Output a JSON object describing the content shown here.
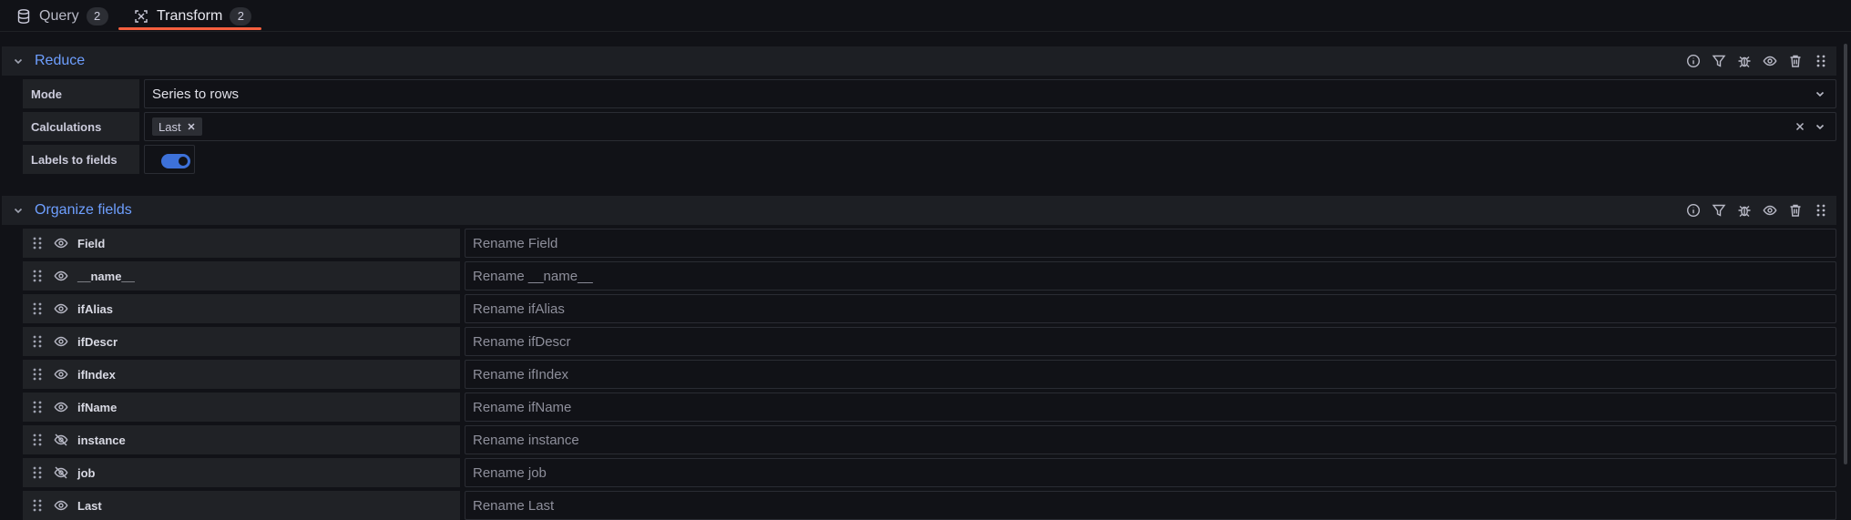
{
  "tabs": [
    {
      "label": "Query",
      "count": "2",
      "icon": "database-icon"
    },
    {
      "label": "Transform",
      "count": "2",
      "icon": "transform-icon"
    }
  ],
  "reduce": {
    "title": "Reduce",
    "mode_label": "Mode",
    "mode_value": "Series to rows",
    "calculations_label": "Calculations",
    "calculations_chip": "Last",
    "labels_to_fields_label": "Labels to fields",
    "labels_to_fields_on": true
  },
  "organize": {
    "title": "Organize fields",
    "fields": [
      {
        "name": "Field",
        "placeholder": "Rename Field",
        "visible": true
      },
      {
        "name": "__name__",
        "placeholder": "Rename __name__",
        "visible": true
      },
      {
        "name": "ifAlias",
        "placeholder": "Rename ifAlias",
        "visible": true
      },
      {
        "name": "ifDescr",
        "placeholder": "Rename ifDescr",
        "visible": true
      },
      {
        "name": "ifIndex",
        "placeholder": "Rename ifIndex",
        "visible": true
      },
      {
        "name": "ifName",
        "placeholder": "Rename ifName",
        "visible": true
      },
      {
        "name": "instance",
        "placeholder": "Rename instance",
        "visible": false
      },
      {
        "name": "job",
        "placeholder": "Rename job",
        "visible": false
      },
      {
        "name": "Last",
        "placeholder": "Rename Last",
        "visible": true
      }
    ]
  },
  "header_actions": [
    "info-icon",
    "filter-icon",
    "debug-icon",
    "eye-icon",
    "trash-icon",
    "drag-handle-icon"
  ],
  "colors": {
    "accent": "#6e9fff",
    "tab_underline": "#f55f3e",
    "toggle": "#3d71d9"
  }
}
